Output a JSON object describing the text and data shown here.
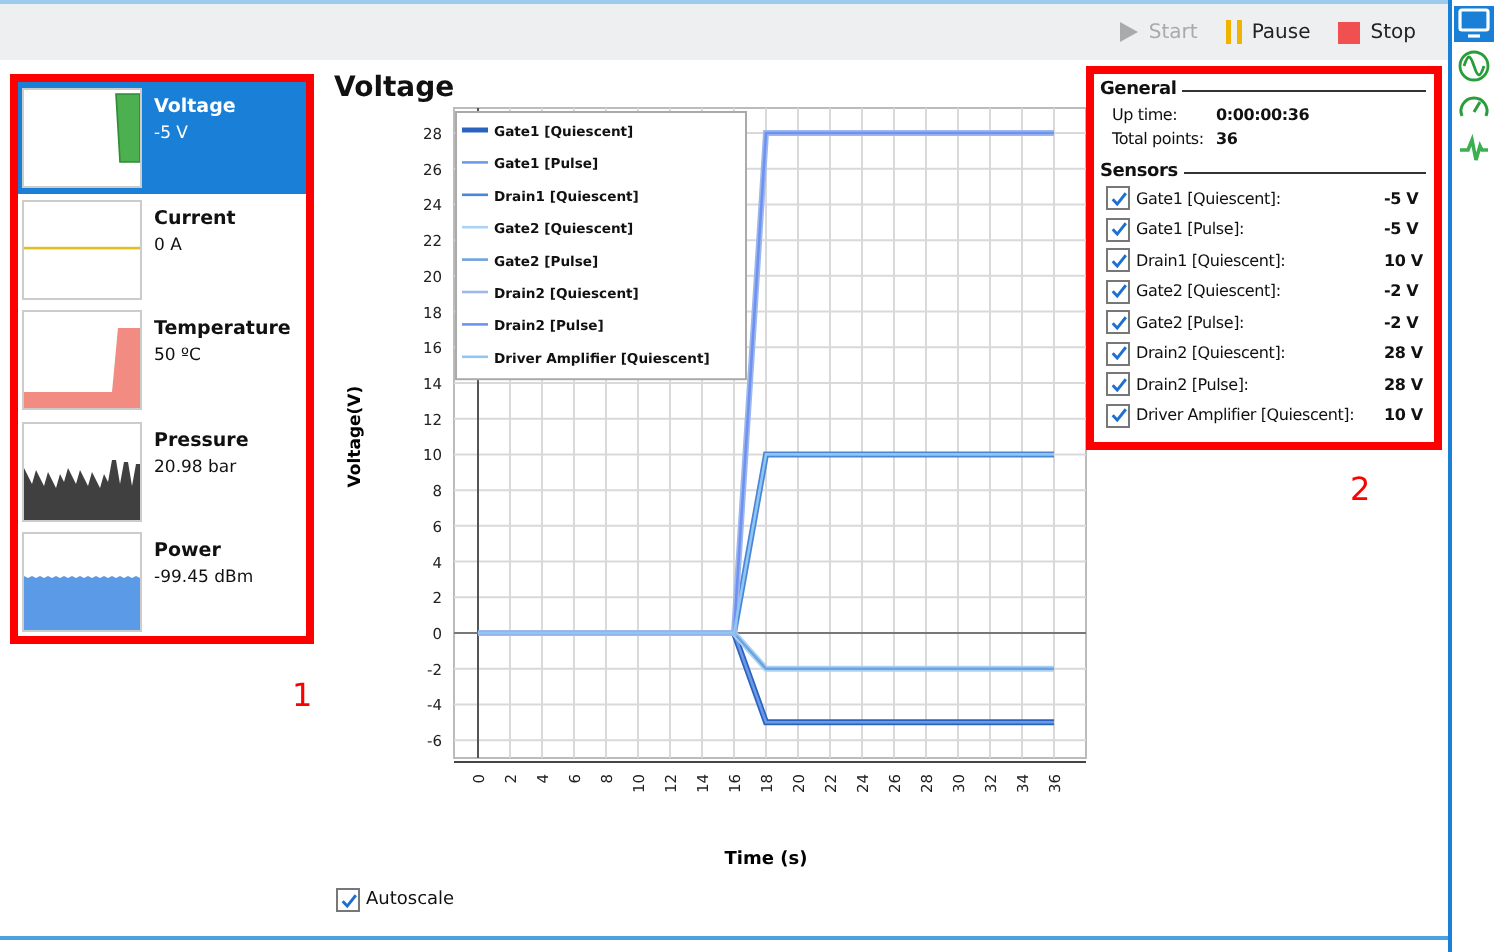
{
  "toolbar": {
    "buttons": [
      {
        "label": "Start",
        "kind": "start",
        "disabled": true
      },
      {
        "label": "Pause",
        "kind": "pause",
        "disabled": false
      },
      {
        "label": "Stop",
        "kind": "stop",
        "disabled": false
      }
    ]
  },
  "side_tabs": [
    {
      "kind": "monitor",
      "selected": true
    },
    {
      "kind": "waveform",
      "selected": false
    },
    {
      "kind": "gauge",
      "selected": false
    },
    {
      "kind": "pulse",
      "selected": false
    }
  ],
  "sensor_list": [
    {
      "name": "Voltage",
      "value": "-5 V",
      "kind": "voltage",
      "color": "#4caf50",
      "selected": true
    },
    {
      "name": "Current",
      "value": "0 A",
      "kind": "current",
      "color": "#e0c020",
      "selected": false
    },
    {
      "name": "Temperature",
      "value": "50 ºC",
      "kind": "temperature",
      "color": "#f28b82",
      "selected": false
    },
    {
      "name": "Pressure",
      "value": "20.98 bar",
      "kind": "pressure",
      "color": "#404040",
      "selected": false
    },
    {
      "name": "Power",
      "value": "-99.45 dBm",
      "kind": "power",
      "color": "#5a9ae6",
      "selected": false
    }
  ],
  "chart_title": "Voltage",
  "chart_data": {
    "type": "line",
    "grid": true,
    "legend": "upper left",
    "xlabel": "Time (s)",
    "ylabel": "Voltage(V)",
    "x": [
      0,
      16,
      18,
      36
    ],
    "series": [
      {
        "name": "Gate1 [Quiescent]",
        "color": "#2a62c0",
        "values": [
          0,
          0,
          -5,
          -5
        ]
      },
      {
        "name": "Gate1 [Pulse]",
        "color": "#6c9be6",
        "values": [
          0,
          0,
          -5,
          -5
        ]
      },
      {
        "name": "Drain1 [Quiescent]",
        "color": "#4a86d8",
        "values": [
          0,
          0,
          10,
          10
        ]
      },
      {
        "name": "Gate2 [Quiescent]",
        "color": "#a9d2f6",
        "values": [
          0,
          0,
          -2,
          -2
        ]
      },
      {
        "name": "Gate2 [Pulse]",
        "color": "#6ea3dc",
        "values": [
          0,
          0,
          -2,
          -2
        ]
      },
      {
        "name": "Drain2 [Quiescent]",
        "color": "#9fb8ec",
        "values": [
          0,
          0,
          28,
          28
        ]
      },
      {
        "name": "Drain2 [Pulse]",
        "color": "#6f92f2",
        "values": [
          0,
          0,
          28,
          28
        ]
      },
      {
        "name": "Driver Amplifier [Quiescent]",
        "color": "#8fc6f2",
        "values": [
          0,
          0,
          10,
          10
        ]
      }
    ],
    "xlim": [
      -1.5,
      38
    ],
    "ylim": [
      -7,
      29.4
    ],
    "xticks": [
      0,
      2,
      4,
      6,
      8,
      10,
      12,
      14,
      16,
      18,
      20,
      22,
      24,
      26,
      28,
      30,
      32,
      34,
      36
    ],
    "yticks": [
      -6,
      -4,
      -2,
      0,
      2,
      4,
      6,
      8,
      10,
      12,
      14,
      16,
      18,
      20,
      22,
      24,
      26,
      28
    ]
  },
  "autoscale": {
    "label": "Autoscale",
    "checked": true
  },
  "general": {
    "title": "General",
    "rows": [
      {
        "label": "Up time:",
        "value": "0:00:00:36"
      },
      {
        "label": "Total points:",
        "value": "36"
      }
    ]
  },
  "sensors": {
    "title": "Sensors",
    "rows": [
      {
        "label": "Gate1 [Quiescent]:",
        "value": "-5 V",
        "checked": true
      },
      {
        "label": "Gate1 [Pulse]:",
        "value": "-5 V",
        "checked": true
      },
      {
        "label": "Drain1 [Quiescent]:",
        "value": "10 V",
        "checked": true
      },
      {
        "label": "Gate2 [Quiescent]:",
        "value": "-2 V",
        "checked": true
      },
      {
        "label": "Gate2 [Pulse]:",
        "value": "-2 V",
        "checked": true
      },
      {
        "label": "Drain2 [Quiescent]:",
        "value": "28 V",
        "checked": true
      },
      {
        "label": "Drain2 [Pulse]:",
        "value": "28 V",
        "checked": true
      },
      {
        "label": "Driver Amplifier [Quiescent]:",
        "value": "10 V",
        "checked": true
      }
    ]
  },
  "annotations": [
    {
      "label": "1"
    },
    {
      "label": "2"
    }
  ]
}
